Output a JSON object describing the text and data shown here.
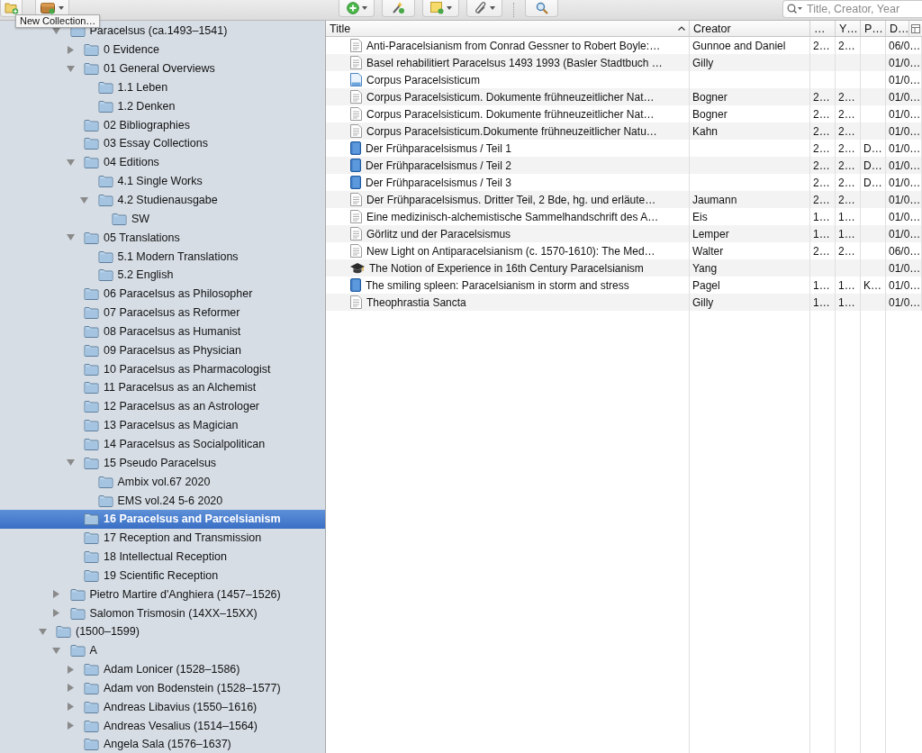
{
  "toolbar": {
    "tooltip": "New Collection…"
  },
  "search": {
    "placeholder": "Title, Creator, Year"
  },
  "collections_partial": [
    {
      "label": "Paracelsus (ca.1493–1541)",
      "expanded": true,
      "selected": false,
      "children": [
        {
          "label": "0 Evidence",
          "expanded": false,
          "selected": false
        },
        {
          "label": "01 General Overviews",
          "expanded": true,
          "selected": false,
          "children": [
            {
              "label": "1.1 Leben",
              "selected": false
            },
            {
              "label": "1.2 Denken",
              "selected": false
            }
          ]
        },
        {
          "label": "02 Bibliographies",
          "selected": false
        },
        {
          "label": "03 Essay Collections",
          "selected": false
        },
        {
          "label": "04 Editions",
          "expanded": true,
          "selected": false,
          "children": [
            {
              "label": "4.1 Single Works",
              "selected": false
            },
            {
              "label": "4.2 Studienausgabe",
              "expanded": true,
              "selected": false,
              "children": [
                {
                  "label": "SW",
                  "selected": false
                }
              ]
            }
          ]
        },
        {
          "label": "05 Translations",
          "expanded": true,
          "selected": false,
          "children": [
            {
              "label": "5.1 Modern Translations",
              "selected": false
            },
            {
              "label": "5.2 English",
              "selected": false
            }
          ]
        },
        {
          "label": "06 Paracelsus as Philosopher",
          "selected": false
        },
        {
          "label": "07 Paracelsus as Reformer",
          "selected": false
        },
        {
          "label": "08 Paracelsus as Humanist",
          "selected": false
        },
        {
          "label": "09 Paracelsus as Physician",
          "selected": false
        },
        {
          "label": "10 Paracelsus as Pharmacologist",
          "selected": false
        },
        {
          "label": "11 Paracelsus as an Alchemist",
          "selected": false
        },
        {
          "label": "12 Paracelsus as an Astrologer",
          "selected": false
        },
        {
          "label": "13 Paracelsus as Magician",
          "selected": false
        },
        {
          "label": "14 Paracelsus as Socialpolitican",
          "selected": false
        },
        {
          "label": "15 Pseudo Paracelsus",
          "expanded": true,
          "selected": false,
          "children": [
            {
              "label": "Ambix vol.67 2020",
              "selected": false
            },
            {
              "label": "EMS vol.24 5-6 2020",
              "selected": false
            }
          ]
        },
        {
          "label": "16 Paracelsus and Parcelsianism",
          "selected": true
        },
        {
          "label": "17 Reception and Transmission",
          "selected": false
        },
        {
          "label": "18 Intellectual Reception",
          "selected": false
        },
        {
          "label": "19 Scientific Reception",
          "selected": false
        }
      ]
    },
    {
      "label": "Pietro Martire d'Anghiera (1457–1526)",
      "expanded": false,
      "selected": false
    },
    {
      "label": "Salomon Trismosin (14XX–15XX)",
      "expanded": false,
      "selected": false
    }
  ],
  "collections": [
    {
      "label": "(1500–1599)",
      "expanded": true,
      "selected": false,
      "children": [
        {
          "label": "A",
          "expanded": true,
          "selected": false,
          "children": [
            {
              "label": "Adam Lonicer (1528–1586)",
              "expanded": false,
              "selected": false
            },
            {
              "label": "Adam von Bodenstein (1528–1577)",
              "expanded": false,
              "selected": false
            },
            {
              "label": "Andreas Libavius (1550–1616)",
              "expanded": false,
              "selected": false
            },
            {
              "label": "Andreas Vesalius (1514–1564)",
              "expanded": false,
              "selected": false
            },
            {
              "label": "Angela Sala (1576–1637)",
              "selected": false
            }
          ]
        }
      ]
    }
  ],
  "table": {
    "columns": [
      {
        "label": "Title",
        "sorted": true
      },
      {
        "label": "Creator",
        "sorted": false
      },
      {
        "label": "…",
        "sorted": false
      },
      {
        "label": "Y…",
        "sorted": false
      },
      {
        "label": "P…",
        "sorted": false
      },
      {
        "label": "D…",
        "sorted": false
      }
    ],
    "rows": [
      {
        "kind": "article",
        "title": "Anti-Paracelsianism from Conrad Gessner to Robert Boyle:…",
        "creator": "Gunnoe and Daniel",
        "column_3": "2…",
        "column_4": "2…",
        "column_6": "06/0…"
      },
      {
        "kind": "article",
        "title": "Basel rehabilitiert Paracelsus 1493 1993 (Basler Stadtbuch …",
        "creator": "Gilly",
        "column_6": "01/0…"
      },
      {
        "kind": "document",
        "title": "Corpus Paracelsisticum",
        "column_6": "01/0…"
      },
      {
        "kind": "article",
        "title": "Corpus Paracelsisticum. Dokumente frühneuzeitlicher Nat…",
        "creator": "Bogner",
        "column_3": "2…",
        "column_4": "2…",
        "column_6": "01/0…"
      },
      {
        "kind": "article",
        "title": "Corpus Paracelsisticum. Dokumente frühneuzeitlicher Nat…",
        "creator": "Bogner",
        "column_3": "2…",
        "column_4": "2…",
        "column_6": "01/0…"
      },
      {
        "kind": "article",
        "title": "Corpus Paracelsisticum.Dokumente frühneuzeitlicher Natu…",
        "creator": "Kahn",
        "column_3": "2…",
        "column_4": "2…",
        "column_6": "01/0…"
      },
      {
        "kind": "book",
        "title": "Der Frühparacelsismus / Teil 1",
        "column_3": "2…",
        "column_4": "2…",
        "column_5": "D…",
        "column_6": "01/0…"
      },
      {
        "kind": "book",
        "title": "Der Frühparacelsismus / Teil 2",
        "column_3": "2…",
        "column_4": "2…",
        "column_5": "D…",
        "column_6": "01/0…"
      },
      {
        "kind": "book",
        "title": "Der Frühparacelsismus / Teil 3",
        "column_3": "2…",
        "column_4": "2…",
        "column_5": "D…",
        "column_6": "01/0…"
      },
      {
        "kind": "article",
        "title": "Der Frühparacelsismus. Dritter Teil, 2 Bde, hg. und erläute…",
        "creator": "Jaumann",
        "column_3": "2…",
        "column_4": "2…",
        "column_6": "01/0…"
      },
      {
        "kind": "article",
        "title": "Eine medizinisch-alchemistische Sammelhandschrift des A…",
        "creator": "Eis",
        "column_3": "1…",
        "column_4": "1…",
        "column_6": "01/0…"
      },
      {
        "kind": "article",
        "title": "Görlitz und der Paracelsismus",
        "creator": "Lemper",
        "column_3": "1…",
        "column_4": "1…",
        "column_6": "01/0…"
      },
      {
        "kind": "article",
        "title": "New Light on Antiparacelsianism (c. 1570-1610): The Med…",
        "creator": "Walter",
        "column_3": "2…",
        "column_4": "2…",
        "column_6": "06/0…"
      },
      {
        "kind": "thesis",
        "title": "The Notion of Experience in 16th Century Paracelsianism",
        "creator": "Yang",
        "column_6": "01/0…"
      },
      {
        "kind": "book",
        "title": "The smiling spleen: Paracelsianism in storm and stress",
        "creator": "Pagel",
        "column_3": "1…",
        "column_4": "1…",
        "column_5": "K…",
        "column_6": "01/0…"
      },
      {
        "kind": "article",
        "title": "Theophrastia Sancta",
        "creator": "Gilly",
        "column_3": "1…",
        "column_4": "1…",
        "column_6": "01/0…"
      }
    ]
  }
}
